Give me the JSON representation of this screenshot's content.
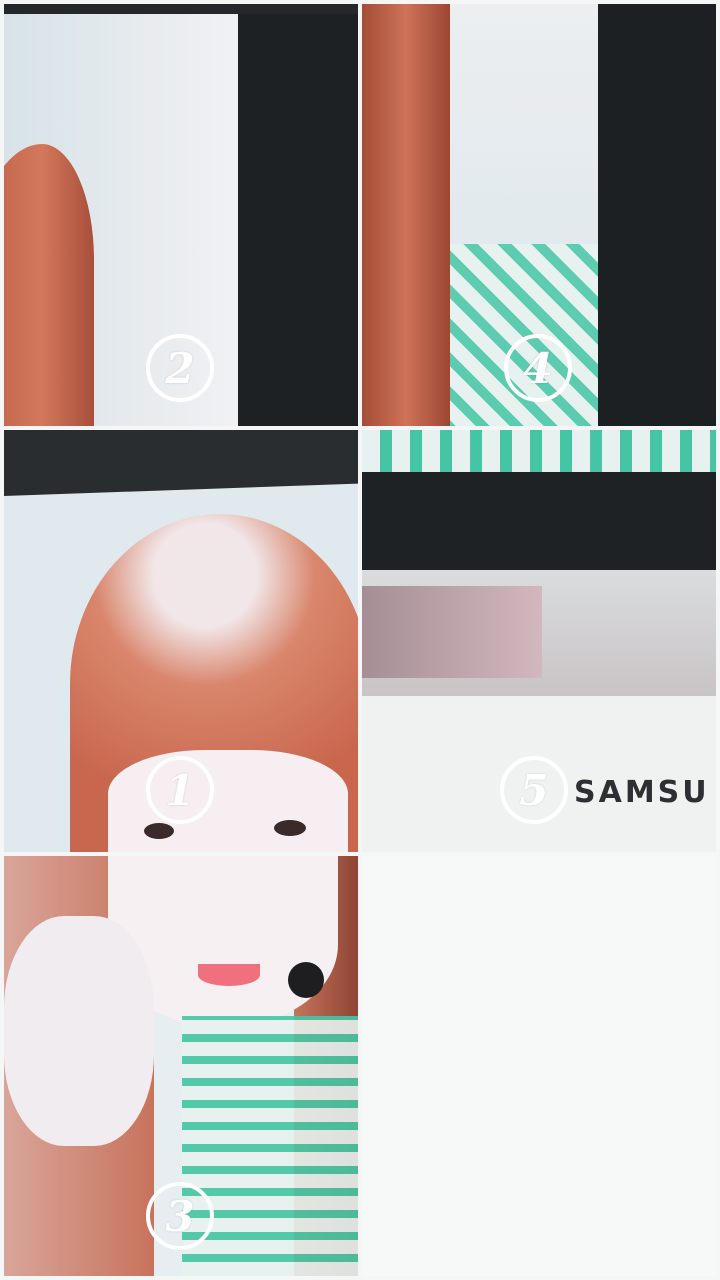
{
  "tiles": [
    {
      "id": "tile-2",
      "number": "2"
    },
    {
      "id": "tile-4",
      "number": "4"
    },
    {
      "id": "tile-1",
      "number": "1"
    },
    {
      "id": "tile-5",
      "number": "5",
      "brand_text": "SAMSU"
    },
    {
      "id": "tile-3",
      "number": "3"
    }
  ],
  "colors": {
    "background": "#f4f7f6",
    "hair": "#c9674e",
    "screen_bezel": "#1f2224",
    "shirt_check": "#3fc6a4",
    "badge_ring": "#ffffff"
  }
}
